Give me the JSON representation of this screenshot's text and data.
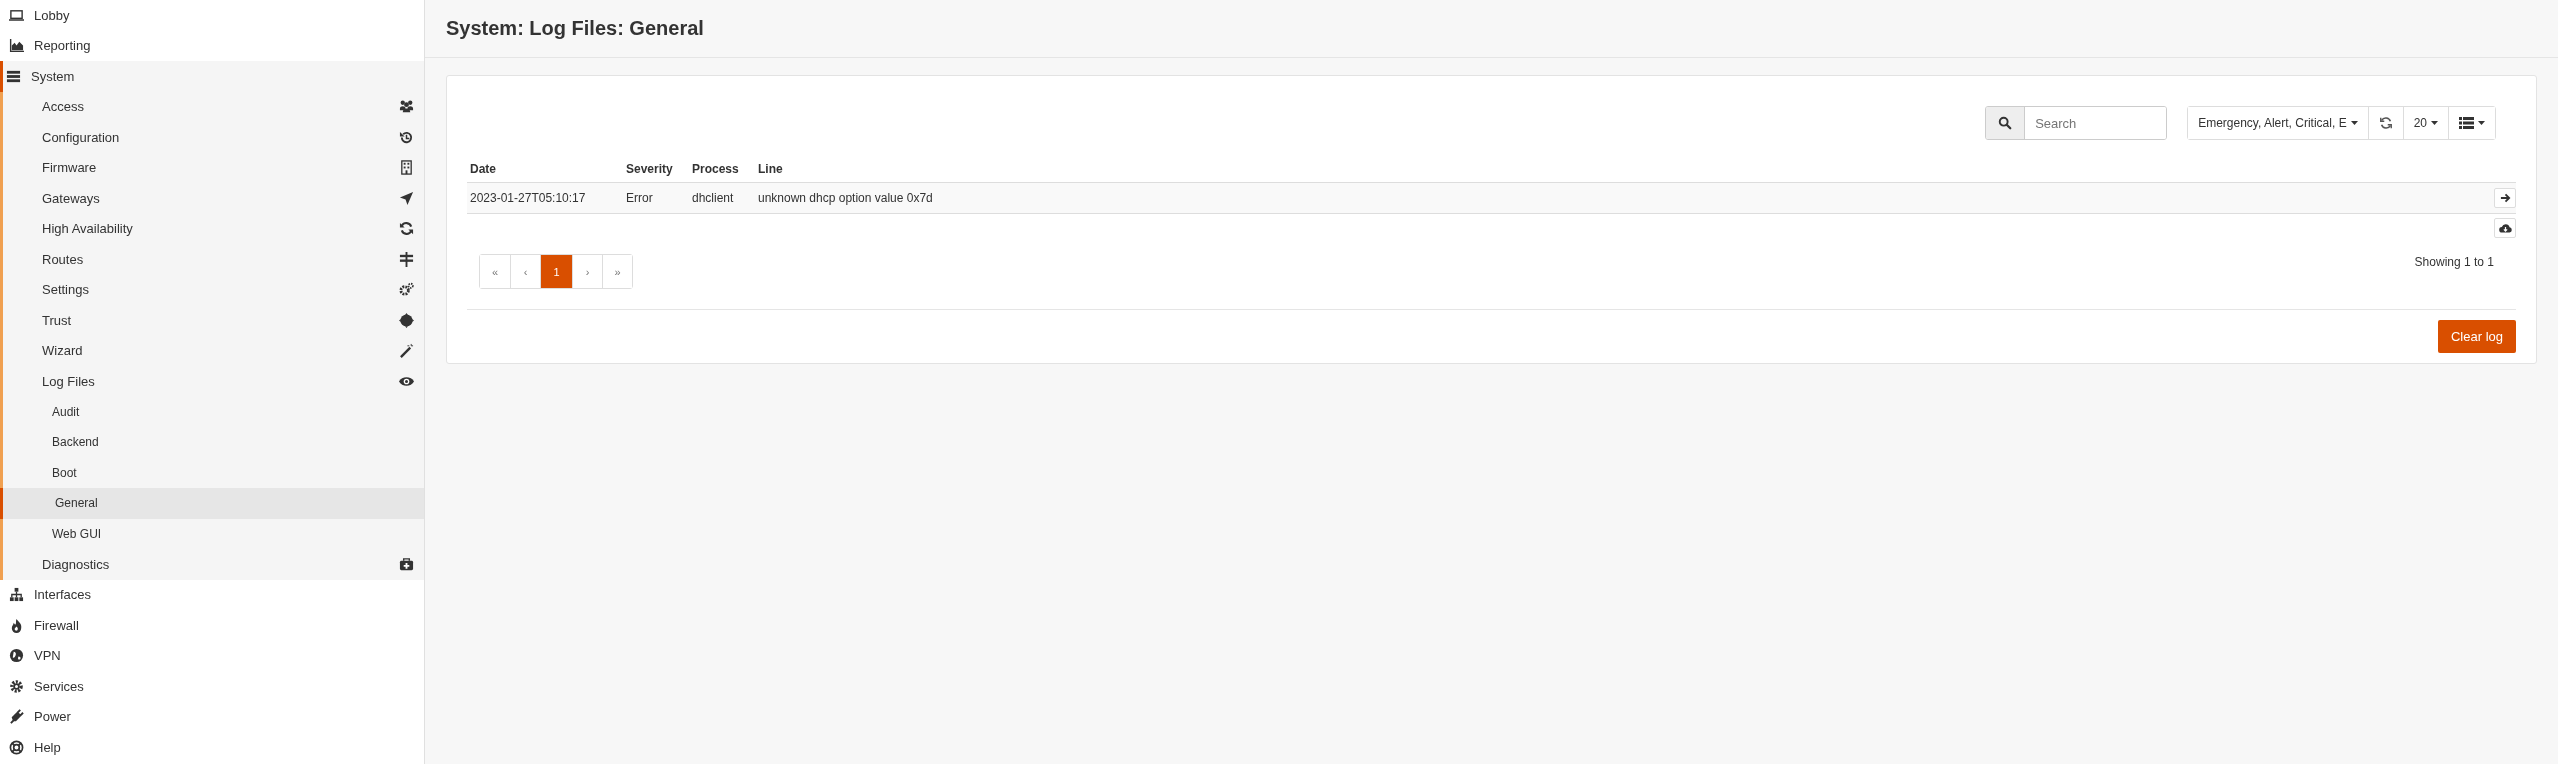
{
  "sidebar": {
    "items": [
      {
        "label": "Lobby",
        "selected": false
      },
      {
        "label": "Reporting",
        "selected": false
      },
      {
        "label": "System",
        "selected": false,
        "expanded": true,
        "children": [
          {
            "label": "Access",
            "selected": false
          },
          {
            "label": "Configuration",
            "selected": false
          },
          {
            "label": "Firmware",
            "selected": false
          },
          {
            "label": "Gateways",
            "selected": false
          },
          {
            "label": "High Availability",
            "selected": false
          },
          {
            "label": "Routes",
            "selected": false
          },
          {
            "label": "Settings",
            "selected": false
          },
          {
            "label": "Trust",
            "selected": false
          },
          {
            "label": "Wizard",
            "selected": false
          },
          {
            "label": "Log Files",
            "selected": false,
            "expanded": true,
            "children": [
              {
                "label": "Audit",
                "selected": false
              },
              {
                "label": "Backend",
                "selected": false
              },
              {
                "label": "Boot",
                "selected": false
              },
              {
                "label": "General",
                "selected": true
              },
              {
                "label": "Web GUI",
                "selected": false
              }
            ]
          },
          {
            "label": "Diagnostics",
            "selected": false
          }
        ]
      },
      {
        "label": "Interfaces",
        "selected": false
      },
      {
        "label": "Firewall",
        "selected": false
      },
      {
        "label": "VPN",
        "selected": false
      },
      {
        "label": "Services",
        "selected": false
      },
      {
        "label": "Power",
        "selected": false
      },
      {
        "label": "Help",
        "selected": false
      }
    ]
  },
  "page_title": "System: Log Files: General",
  "toolbar": {
    "search": {
      "placeholder": "Search"
    },
    "severity_filter": "Emergency, Alert, Critical, E",
    "page_size": "20"
  },
  "table": {
    "columns": [
      "Date",
      "Severity",
      "Process",
      "Line"
    ],
    "rows": [
      [
        "2023-01-27T05:10:17",
        "Error",
        "dhclient",
        "unknown dhcp option value 0x7d"
      ]
    ]
  },
  "pagination": [
    {
      "label": "«",
      "selected": false
    },
    {
      "label": "‹",
      "selected": false
    },
    {
      "label": "1",
      "selected": true
    },
    {
      "label": "›",
      "selected": false
    },
    {
      "label": "»",
      "selected": false
    }
  ],
  "status": "Showing 1 to 1",
  "buttons": [
    "Clear log"
  ]
}
